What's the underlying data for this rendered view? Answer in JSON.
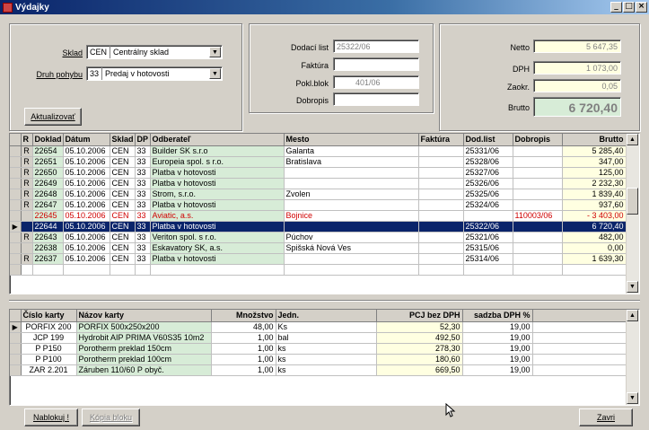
{
  "window": {
    "title": "Výdajky",
    "min": "_",
    "max": "□",
    "close": "×"
  },
  "filters": {
    "sklad_label": "Sklad",
    "sklad_code": "CEN",
    "sklad_name": "Centrálny sklad",
    "druh_label": "Druh pohybu",
    "druh_code": "33",
    "druh_name": "Predaj v hotovosti",
    "refresh_label": "Aktualizovať"
  },
  "docs": {
    "dodaci_label": "Dodací list",
    "dodaci_value": "25322/06",
    "faktura_label": "Faktúra",
    "faktura_value": "",
    "pokl_label": "Pokl.blok",
    "pokl_value": "401/06",
    "dobropis_label": "Dobropis",
    "dobropis_value": ""
  },
  "totals": {
    "netto_label": "Netto",
    "netto_value": "5 647,35",
    "dph_label": "DPH",
    "dph_value": "1 073,00",
    "zaokr_label": "Zaokr.",
    "zaokr_value": "0,05",
    "brutto_label": "Brutto",
    "brutto_value": "6 720,40"
  },
  "main_table": {
    "headers": [
      "R",
      "Doklad",
      "Dátum",
      "Sklad",
      "DP",
      "Odberateľ",
      "Mesto",
      "Faktúra",
      "Dod.list",
      "Dobropis",
      "Brutto"
    ],
    "rows": [
      {
        "r": "R",
        "doklad": "22654",
        "datum": "05.10.2006",
        "sklad": "CEN",
        "dp": "33",
        "odb": "Builder SK s.r.o",
        "mesto": "Galanta",
        "fakt": "",
        "dod": "25331/06",
        "dobr": "",
        "brutto": "5 285,40"
      },
      {
        "r": "R",
        "doklad": "22651",
        "datum": "05.10.2006",
        "sklad": "CEN",
        "dp": "33",
        "odb": "Europeia spol. s r.o.",
        "mesto": "Bratislava",
        "fakt": "",
        "dod": "25328/06",
        "dobr": "",
        "brutto": "347,00"
      },
      {
        "r": "R",
        "doklad": "22650",
        "datum": "05.10.2006",
        "sklad": "CEN",
        "dp": "33",
        "odb": "Platba v hotovosti",
        "mesto": "",
        "fakt": "",
        "dod": "25327/06",
        "dobr": "",
        "brutto": "125,00"
      },
      {
        "r": "R",
        "doklad": "22649",
        "datum": "05.10.2006",
        "sklad": "CEN",
        "dp": "33",
        "odb": "Platba v hotovosti",
        "mesto": "",
        "fakt": "",
        "dod": "25326/06",
        "dobr": "",
        "brutto": "2 232,30"
      },
      {
        "r": "R",
        "doklad": "22648",
        "datum": "05.10.2006",
        "sklad": "CEN",
        "dp": "33",
        "odb": "Strom, s.r.o.",
        "mesto": "Zvolen",
        "fakt": "",
        "dod": "25325/06",
        "dobr": "",
        "brutto": "1 839,40"
      },
      {
        "r": "R",
        "doklad": "22647",
        "datum": "05.10.2006",
        "sklad": "CEN",
        "dp": "33",
        "odb": "Platba v hotovosti",
        "mesto": "",
        "fakt": "",
        "dod": "25324/06",
        "dobr": "",
        "brutto": "937,60"
      },
      {
        "r": "",
        "doklad": "22645",
        "datum": "05.10.2006",
        "sklad": "CEN",
        "dp": "33",
        "odb": "Aviatic, a.s.",
        "mesto": "Bojnice",
        "fakt": "",
        "dod": "",
        "dobr": "110003/06",
        "brutto": "- 3 403,00"
      },
      {
        "r": "",
        "doklad": "22644",
        "datum": "05.10.2006",
        "sklad": "CEN",
        "dp": "33",
        "odb": "Platba v hotovosti",
        "mesto": "",
        "fakt": "",
        "dod": "25322/06",
        "dobr": "",
        "brutto": "6 720,40"
      },
      {
        "r": "R",
        "doklad": "22643",
        "datum": "05.10.2006",
        "sklad": "CEN",
        "dp": "33",
        "odb": "Veriton spol. s r.o.",
        "mesto": "Púchov",
        "fakt": "",
        "dod": "25321/06",
        "dobr": "",
        "brutto": "482,00"
      },
      {
        "r": "",
        "doklad": "22638",
        "datum": "05.10.2006",
        "sklad": "CEN",
        "dp": "33",
        "odb": "Eskavatory SK, a.s.",
        "mesto": "Spišská Nová Ves",
        "fakt": "",
        "dod": "25315/06",
        "dobr": "",
        "brutto": "0,00"
      },
      {
        "r": "R",
        "doklad": "22637",
        "datum": "05.10.2006",
        "sklad": "CEN",
        "dp": "33",
        "odb": "Platba v hotovosti",
        "mesto": "",
        "fakt": "",
        "dod": "25314/06",
        "dobr": "",
        "brutto": "1 639,30"
      }
    ]
  },
  "items_table": {
    "headers": [
      "Číslo karty",
      "Názov karty",
      "Množstvo",
      "Jedn.",
      "PCJ bez DPH",
      "sadzba DPH %"
    ],
    "rows": [
      {
        "cislo": "PORFIX 200",
        "nazov": "PORFIX 500x250x200",
        "mnoz": "48,00",
        "jedn": "Ks",
        "pcj": "52,30",
        "sadzba": "19,00"
      },
      {
        "cislo": "JCP 199",
        "nazov": "Hydrobit AIP PRIMA V60S35 10m2",
        "mnoz": "1,00",
        "jedn": "bal",
        "pcj": "492,50",
        "sadzba": "19,00"
      },
      {
        "cislo": "P P150",
        "nazov": "Porotherm preklad 150cm",
        "mnoz": "1,00",
        "jedn": "ks",
        "pcj": "278,30",
        "sadzba": "19,00"
      },
      {
        "cislo": "P P100",
        "nazov": "Porotherm preklad 100cm",
        "mnoz": "1,00",
        "jedn": "ks",
        "pcj": "180,60",
        "sadzba": "19,00"
      },
      {
        "cislo": "ZAR 2.201",
        "nazov": "Záruben 110/60 P obyč.",
        "mnoz": "1,00",
        "jedn": "ks",
        "pcj": "669,50",
        "sadzba": "19,00"
      }
    ]
  },
  "buttons": {
    "block": "Nablokuj !",
    "copy": "Kópia bloku",
    "close": "Zavri"
  },
  "colors": {
    "selection": "#0a246a",
    "negative": "#d00000",
    "green_col": "#d7ecd7",
    "yellow_col": "#ffffe1"
  },
  "icons": {
    "row_indicator": "triangle-right",
    "scroll_up": "triangle-up",
    "scroll_down": "triangle-down"
  }
}
